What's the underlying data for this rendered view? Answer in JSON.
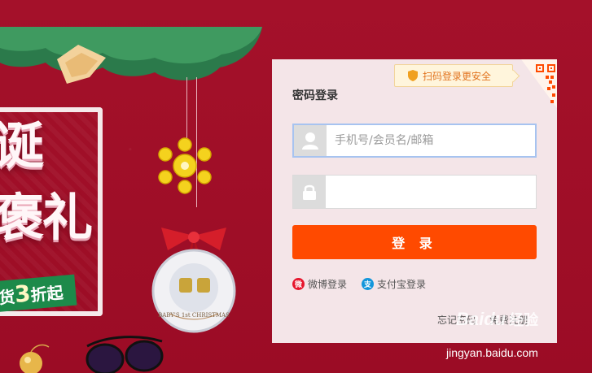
{
  "promo": {
    "title_line1": "诞",
    "title_line2": "褒礼",
    "ribbon_prefix": "货",
    "ribbon_number": "3",
    "ribbon_suffix": "折起",
    "ornament_text": "BABY'S 1st CHRISTMAS"
  },
  "login": {
    "qr_tip": "扫码登录更安全",
    "title": "密码登录",
    "username_placeholder": "手机号/会员名/邮箱",
    "username_value": "",
    "password_value": "",
    "submit_label": "登 录",
    "alt_logins": [
      {
        "label": "微博登录",
        "icon": "weibo-icon"
      },
      {
        "label": "支付宝登录",
        "icon": "alipay-icon"
      }
    ],
    "forgot_password": "忘记密码",
    "register": "免费注册"
  },
  "watermark": {
    "brand": "Baidu",
    "brand_cn": "经验",
    "url": "jingyan.baidu.com"
  },
  "colors": {
    "background": "#9e0f24",
    "panel": "#f4e5e8",
    "primary_button": "#ff4a00",
    "qr_tip_text": "#e2741f",
    "weibo": "#e6162d",
    "alipay": "#1296db"
  }
}
